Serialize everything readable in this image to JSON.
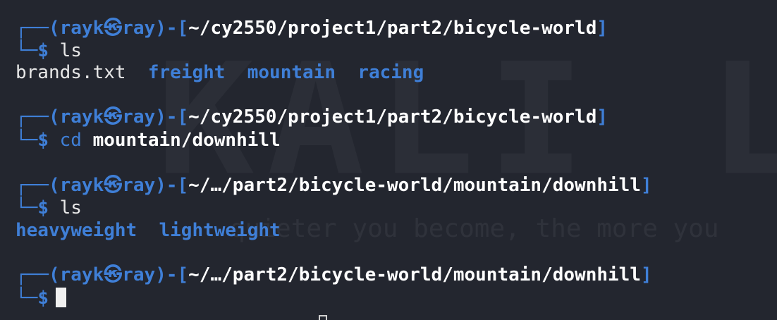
{
  "watermark": {
    "logo_text": "KALI LOO",
    "quote_text": "quieter you become, the more you"
  },
  "blocks": [
    {
      "prompt": {
        "top_left": "┌──(",
        "user": "rayk㉿ray",
        "mid": ")-[",
        "path": "~/cy2550/project1/part2/bicycle-world",
        "end": "]",
        "bottom_left": "└─",
        "dollar": "$"
      },
      "command": "ls",
      "args": "",
      "output": [
        {
          "text": "brands.txt",
          "kind": "file"
        },
        {
          "text": "freight",
          "kind": "dir"
        },
        {
          "text": "mountain",
          "kind": "dir"
        },
        {
          "text": "racing",
          "kind": "dir"
        }
      ]
    },
    {
      "prompt": {
        "top_left": "┌──(",
        "user": "rayk㉿ray",
        "mid": ")-[",
        "path": "~/cy2550/project1/part2/bicycle-world",
        "end": "]",
        "bottom_left": "└─",
        "dollar": "$"
      },
      "command": "cd",
      "args": "mountain/downhill",
      "output": []
    },
    {
      "prompt": {
        "top_left": "┌──(",
        "user": "rayk㉿ray",
        "mid": ")-[",
        "path": "~/…/part2/bicycle-world/mountain/downhill",
        "end": "]",
        "bottom_left": "└─",
        "dollar": "$"
      },
      "command": "ls",
      "args": "",
      "output": [
        {
          "text": "heavyweight",
          "kind": "dir"
        },
        {
          "text": "lightweight",
          "kind": "dir"
        }
      ]
    },
    {
      "prompt": {
        "top_left": "┌──(",
        "user": "rayk㉿ray",
        "mid": ")-[",
        "path": "~/…/part2/bicycle-world/mountain/downhill",
        "end": "]",
        "bottom_left": "└─",
        "dollar": "$"
      },
      "command": "",
      "args": "",
      "output": []
    }
  ],
  "colors": {
    "background": "#23262f",
    "accent_blue": "#3f7fd7",
    "text": "#e7e7e7"
  }
}
